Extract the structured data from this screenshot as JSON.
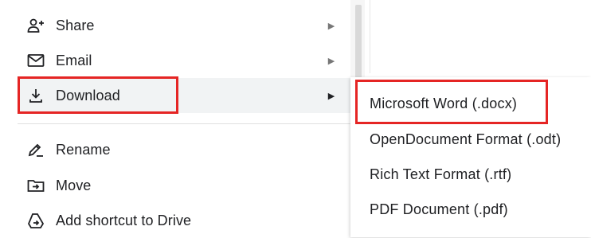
{
  "menu": {
    "items": [
      {
        "label": "Share",
        "icon": "share-person-icon",
        "has_submenu": true
      },
      {
        "label": "Email",
        "icon": "mail-icon",
        "has_submenu": true
      },
      {
        "label": "Download",
        "icon": "download-icon",
        "has_submenu": true
      },
      {
        "label": "Rename",
        "icon": "pencil-icon",
        "has_submenu": false
      },
      {
        "label": "Move",
        "icon": "folder-move-icon",
        "has_submenu": false
      },
      {
        "label": "Add shortcut to Drive",
        "icon": "drive-shortcut-icon",
        "has_submenu": false
      }
    ]
  },
  "submenu": {
    "items": [
      {
        "label": "Microsoft Word (.docx)"
      },
      {
        "label": "OpenDocument Format (.odt)"
      },
      {
        "label": "Rich Text Format (.rtf)"
      },
      {
        "label": "PDF Document (.pdf)"
      }
    ]
  },
  "colors": {
    "highlight_border": "#e52524",
    "hover_background": "#f1f3f4",
    "text": "#202124"
  }
}
